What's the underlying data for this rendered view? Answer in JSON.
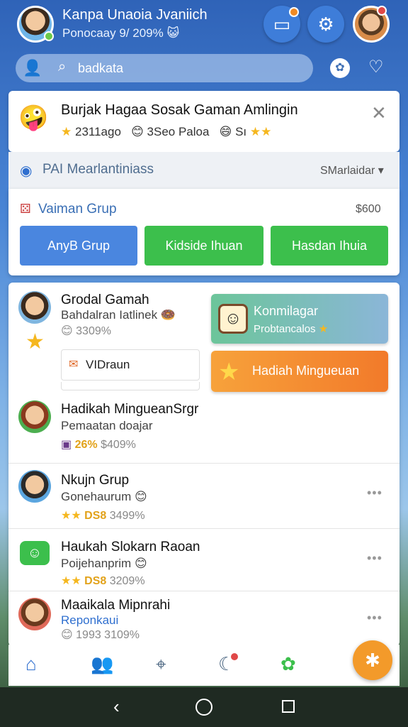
{
  "header": {
    "title": "Kanpa Unaoia Jvaniich",
    "subtitle": "Ponocaay 9/ 209%",
    "subtitle_emoji": "😺",
    "cards_icon": "cards-icon",
    "settings_icon": "gear-icon",
    "profile_icon": "avatar"
  },
  "search": {
    "text": "badkata"
  },
  "banner": {
    "title": "Burjak Hagaa Sosak Gaman Amlingin",
    "emoji": "🤪",
    "meta1": "2311ago",
    "meta2": "3Seo Paloa",
    "meta3": "Sı"
  },
  "section": {
    "title": "PAI Mearlantiniass",
    "action": "SMarlaidar"
  },
  "group_card": {
    "title": "Vaiman Grup",
    "value": "$600",
    "buttons": [
      "AnyB Grup",
      "Kidside Ihuan",
      "Hasdan Ihuia"
    ]
  },
  "list": [
    {
      "name": "Grodal Gamah",
      "sub": "Bahdalran Iatlinek",
      "meta": "3309%",
      "input_text": "VIDraun"
    },
    {
      "name": "Hadikah MingueanSrgr",
      "sub": "Pemaatan doajar",
      "meta_bold": "26%",
      "meta": "$409%"
    },
    {
      "name": "Nkujn Grup",
      "sub": "Gonehaurum",
      "meta_bold": "DS8",
      "meta": "3499%"
    },
    {
      "name": "Haukah Slokarn Raoan",
      "sub": "Poijehanprim",
      "meta_bold": "DS8",
      "meta": "3209%"
    },
    {
      "name": "Maaikala Mipnrahi",
      "sub": "Reponkaui",
      "meta": "1993 3109%"
    }
  ],
  "promos": [
    {
      "title": "Konmilagar",
      "sub": "Probtancalos"
    },
    {
      "title": "Hadiah Mingueuan"
    }
  ],
  "colors": {
    "accent_blue": "#4a86df",
    "accent_green": "#3cbf4c",
    "accent_orange": "#f39a2a"
  }
}
